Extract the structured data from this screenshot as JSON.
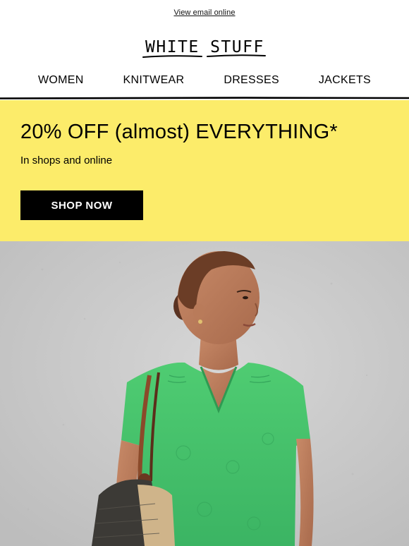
{
  "header": {
    "view_online": "View email online",
    "brand": "WHITE STUFF"
  },
  "nav": {
    "items": [
      "WOMEN",
      "KNITWEAR",
      "DRESSES",
      "JACKETS"
    ]
  },
  "promo": {
    "headline": "20% OFF (almost) EVERYTHING*",
    "subtext": "In shops and online",
    "cta": "SHOP NOW",
    "background": "#fcec6a"
  },
  "hero": {
    "image": "model-green-top-photo",
    "top_color": "#45c46a",
    "backdrop_color": "#cfcfcf"
  }
}
